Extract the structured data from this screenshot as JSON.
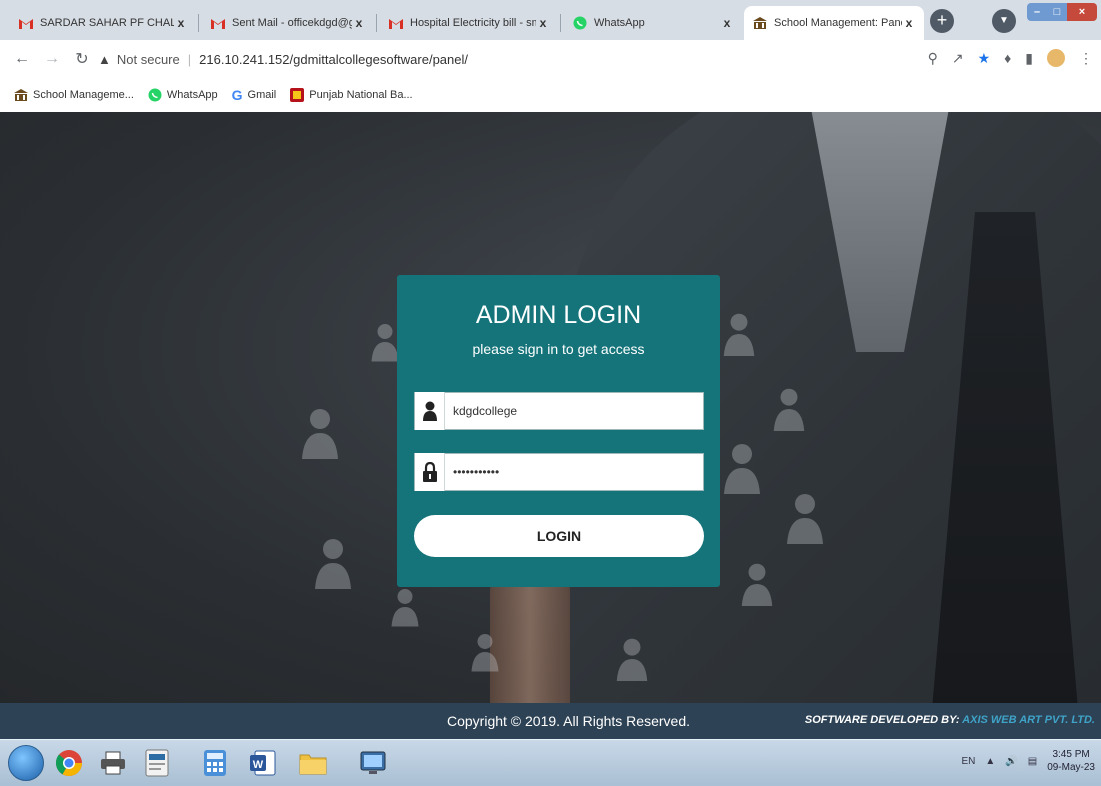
{
  "browser": {
    "tabs": [
      {
        "title": "SARDAR SAHAR PF CHALLANS",
        "icon": "gmail-icon"
      },
      {
        "title": "Sent Mail - officekdgd@gmail.",
        "icon": "gmail-icon"
      },
      {
        "title": "Hospital Electricity bill - smgdc",
        "icon": "gmail-icon"
      },
      {
        "title": "WhatsApp",
        "icon": "whatsapp-icon"
      },
      {
        "title": "School Management: Panel",
        "icon": "school-icon",
        "active": true
      }
    ],
    "tab_close_glyph": "x",
    "new_tab_glyph": "+",
    "address": {
      "security_label": "Not secure",
      "url": "216.10.241.152/gdmittalcollegesoftware/panel/"
    },
    "bookmarks": [
      {
        "label": "School Manageme...",
        "icon": "school-icon"
      },
      {
        "label": "WhatsApp",
        "icon": "whatsapp-icon"
      },
      {
        "label": "Gmail",
        "icon": "google-icon"
      },
      {
        "label": "Punjab National Ba...",
        "icon": "bank-icon"
      }
    ]
  },
  "login": {
    "title": "ADMIN LOGIN",
    "subtitle": "please sign in to get access",
    "username_value": "kdgdcollege",
    "password_value": "•••••••••••",
    "button_label": "LOGIN"
  },
  "footer": {
    "copyright": "Copyright © 2019. All Rights Reserved.",
    "developed_by_label": "SOFTWARE DEVELOPED BY:",
    "developer_name": "AXIS WEB ART PVT. LTD."
  },
  "taskbar": {
    "apps": [
      "chrome-icon",
      "printer-icon",
      "tally-icon",
      "calculator-icon",
      "word-icon",
      "folder-icon",
      "network-icon"
    ],
    "language": "EN",
    "time": "3:45 PM",
    "date": "09-May-23"
  },
  "colors": {
    "login_panel": "#15747a",
    "footer": "#2d4254",
    "developer_link": "#3fa3c8"
  }
}
